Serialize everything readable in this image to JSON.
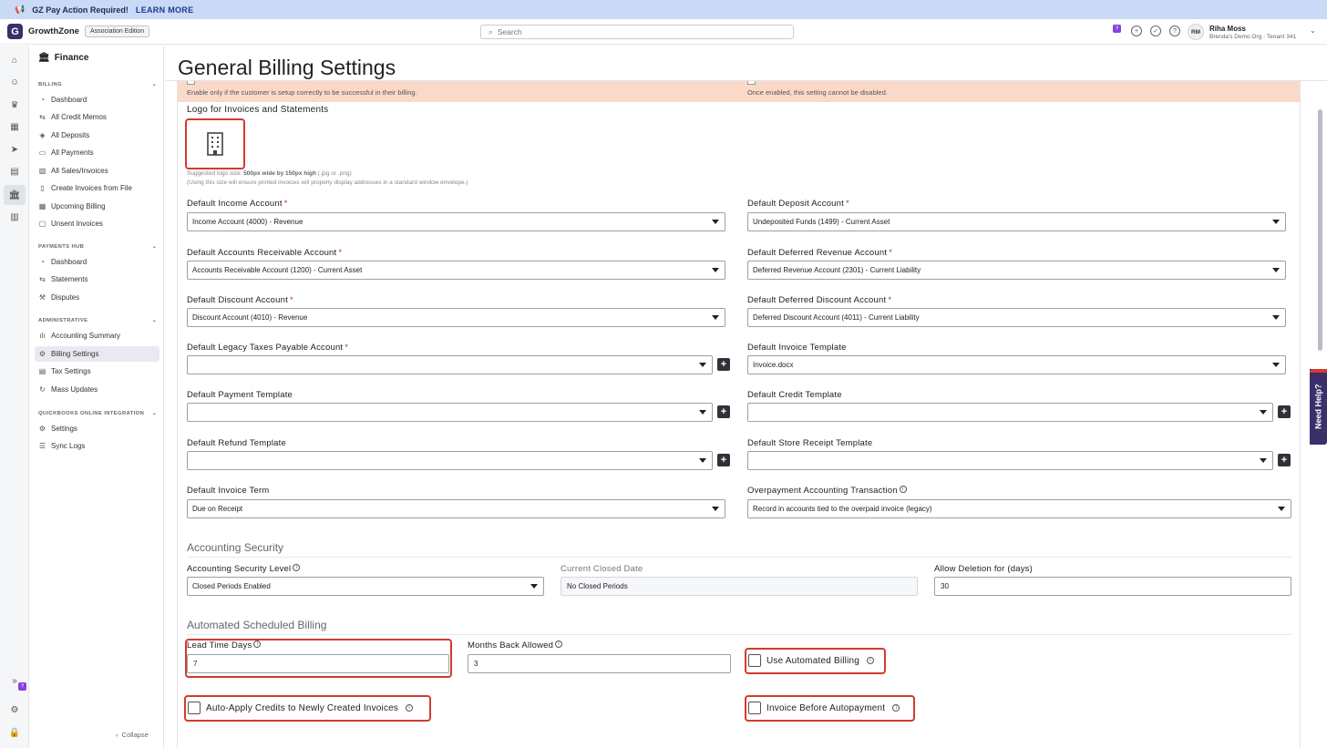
{
  "announcement": {
    "text": "GZ Pay Action Required!",
    "link": "LEARN MORE"
  },
  "topnav": {
    "brand": "GrowthZone",
    "edition": "Association Edition",
    "search_placeholder": "Search",
    "badge": "?",
    "user_initials": "RM",
    "user_name": "Riha Moss",
    "user_org": "Brenda's Demo Org · Tenant 341"
  },
  "sidebar": {
    "title": "Finance",
    "sections": [
      {
        "label": "BILLING",
        "items": [
          "Dashboard",
          "All Credit Memos",
          "All Deposits",
          "All Payments",
          "All Sales/Invoices",
          "Create Invoices from File",
          "Upcoming Billing",
          "Unsent Invoices"
        ]
      },
      {
        "label": "PAYMENTS HUB",
        "items": [
          "Dashboard",
          "Statements",
          "Disputes"
        ]
      },
      {
        "label": "ADMINISTRATIVE",
        "items": [
          "Accounting Summary",
          "Billing Settings",
          "Tax Settings",
          "Mass Updates"
        ]
      },
      {
        "label": "QUICKBOOKS ONLINE INTEGRATION",
        "items": [
          "Settings",
          "Sync Logs"
        ]
      }
    ],
    "collapse": "Collapse"
  },
  "page": {
    "title": "General Billing Settings",
    "alert_left": "Enable only if the customer is setup correctly to be successful in their billing.",
    "alert_right": "Once enabled, this setting cannot be disabled.",
    "logo_label": "Logo for Invoices and Statements",
    "logo_hint_prefix": "Suggested logo size: ",
    "logo_hint_bold": "500px wide  by 150px high",
    "logo_hint_suffix": " (.jpg or .png)",
    "logo_hint_2": "(Using this size will ensure printed invoices will properly display addresses in a standard window envelope.)",
    "fields": {
      "income": {
        "label": "Default Income Account",
        "value": "Income Account (4000) - Revenue"
      },
      "deposit": {
        "label": "Default Deposit Account",
        "value": "Undeposited Funds (1499) - Current Asset"
      },
      "ar": {
        "label": "Default Accounts Receivable Account",
        "value": "Accounts Receivable Account (1200) - Current Asset"
      },
      "deferred_rev": {
        "label": "Default Deferred Revenue Account",
        "value": "Deferred Revenue Account (2301) - Current Liability"
      },
      "discount": {
        "label": "Default Discount Account",
        "value": "Discount Account (4010) - Revenue"
      },
      "deferred_disc": {
        "label": "Default Deferred Discount Account",
        "value": "Deferred Discount Account (4011) - Current Liability"
      },
      "legacy_tax": {
        "label": "Default Legacy Taxes Payable Account",
        "value": ""
      },
      "invoice_tpl": {
        "label": "Default Invoice Template",
        "value": "Invoice.docx"
      },
      "payment_tpl": {
        "label": "Default Payment Template",
        "value": ""
      },
      "credit_tpl": {
        "label": "Default Credit Template",
        "value": ""
      },
      "refund_tpl": {
        "label": "Default Refund Template",
        "value": ""
      },
      "store_tpl": {
        "label": "Default Store Receipt Template",
        "value": ""
      },
      "invoice_term": {
        "label": "Default Invoice Term",
        "value": "Due on Receipt"
      },
      "overpayment": {
        "label": "Overpayment Accounting Transaction",
        "value": "Record in accounts tied to the overpaid invoice (legacy)"
      }
    },
    "security": {
      "heading": "Accounting Security",
      "level_label": "Accounting Security Level",
      "level_value": "Closed Periods Enabled",
      "closed_label": "Current Closed Date",
      "closed_value": "No Closed Periods",
      "deletion_label": "Allow Deletion for (days)",
      "deletion_value": "30"
    },
    "automated": {
      "heading": "Automated Scheduled Billing",
      "lead_label": "Lead Time Days",
      "lead_value": "7",
      "months_label": "Months Back Allowed",
      "months_value": "3",
      "use_auto": "Use Automated Billing",
      "auto_apply": "Auto-Apply Credits to Newly Created Invoices",
      "invoice_before": "Invoice Before Autopayment"
    }
  },
  "need_help": "Need Help?",
  "colors": {
    "highlight": "#d23b2e",
    "brand": "#3a2f6b",
    "alert": "#fbd9c9",
    "announce": "#c9d9f6"
  }
}
